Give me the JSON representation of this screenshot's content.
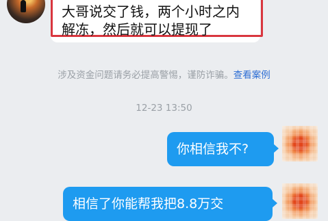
{
  "messages": {
    "incoming": {
      "line1": "大哥说交了钱，两个小时之内",
      "line2": "解冻，然后就可以提现了"
    },
    "notice": {
      "text": "涉及资金问题请务必提高警惕，谨防诈骗。",
      "link": "查看案例"
    },
    "timestamp": "12-23 13:50",
    "outgoing": [
      {
        "text": "你相信我不?"
      },
      {
        "text": "相信了你能帮我把8.8万交"
      }
    ]
  },
  "colors": {
    "bubble_outgoing": "#1e9bf0",
    "highlight_border": "#d9363e",
    "link": "#2f6fd4"
  }
}
